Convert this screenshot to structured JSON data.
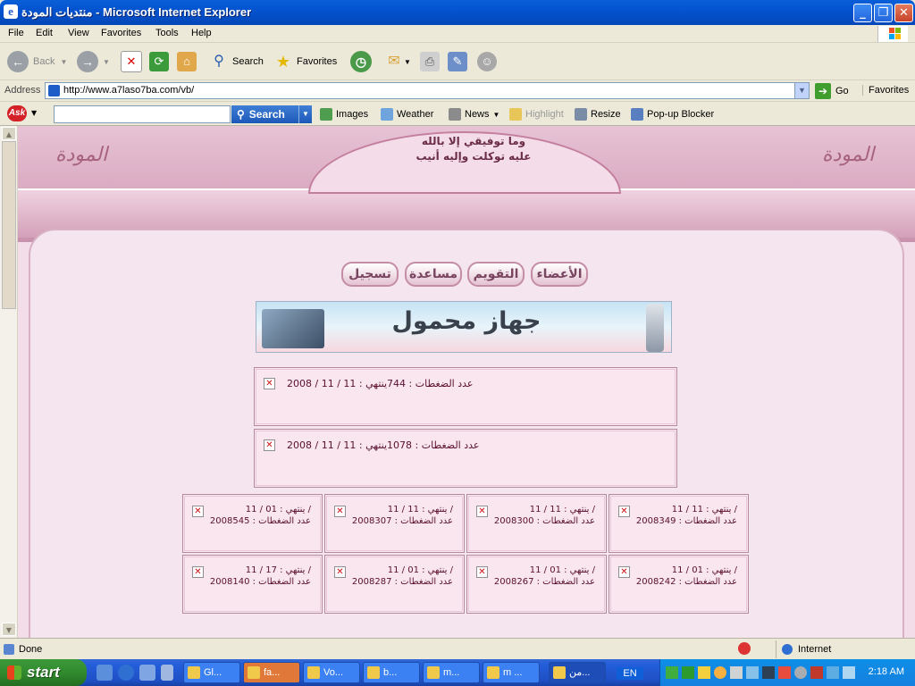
{
  "window": {
    "title": "منتديات المودة - Microsoft Internet Explorer",
    "controls": [
      "_",
      "❐",
      "✕"
    ]
  },
  "menu": [
    "File",
    "Edit",
    "View",
    "Favorites",
    "Tools",
    "Help"
  ],
  "toolbar": {
    "back": "Back",
    "search": "Search",
    "favorites": "Favorites"
  },
  "address": {
    "label": "Address",
    "url": "http://www.a7laso7ba.com/vb/",
    "go": "Go",
    "links": "Favorites"
  },
  "askbar": {
    "logo": "Ask",
    "search_label": "Search",
    "images": "Images",
    "weather": "Weather",
    "news": "News",
    "highlight": "Highlight",
    "resize": "Resize",
    "popup": "Pop-up Blocker"
  },
  "site": {
    "logo_left": "المودة",
    "logo_right": "المودة",
    "motto_line1": "وما توفيقي إلا بالله",
    "motto_line2": "عليه توكلت وإليه أنيب",
    "nav": [
      "الأعضاء",
      "التقويم",
      "مساعدة",
      "تسجيل"
    ],
    "ad_text": "جهاز محمول"
  },
  "ads_large": [
    {
      "text": "عدد الضغطات : 744ينتهي : 11 / 11 / 2008"
    },
    {
      "text": "عدد الضغطات : 1078ينتهي : 11 / 11 / 2008"
    }
  ],
  "ads_small": [
    {
      "line1": "ينتهي : 11 / 11 /",
      "line2": "عدد الضغطات : 2008349"
    },
    {
      "line1": "ينتهي : 11 / 11 /",
      "line2": "عدد الضغطات : 2008300"
    },
    {
      "line1": "ينتهي : 11 / 11 /",
      "line2": "عدد الضغطات : 2008307"
    },
    {
      "line1": "ينتهي : 01 / 11 /",
      "line2": "عدد الضغطات : 2008545"
    },
    {
      "line1": "ينتهي : 01 / 11 /",
      "line2": "عدد الضغطات : 2008242"
    },
    {
      "line1": "ينتهي : 01 / 11 /",
      "line2": "عدد الضغطات : 2008267"
    },
    {
      "line1": "ينتهي : 01 / 11 /",
      "line2": "عدد الضغطات : 2008287"
    },
    {
      "line1": "ينتهي : 17 / 11 /",
      "line2": "عدد الضغطات : 2008140"
    }
  ],
  "status": {
    "text": "Done",
    "zone": "Internet"
  },
  "taskbar": {
    "start": "start",
    "tasks": [
      "Gl...",
      "fa...",
      "Vo...",
      "b...",
      "m...",
      "m ...",
      "من..."
    ],
    "lang": "EN",
    "clock": "2:18 AM"
  }
}
